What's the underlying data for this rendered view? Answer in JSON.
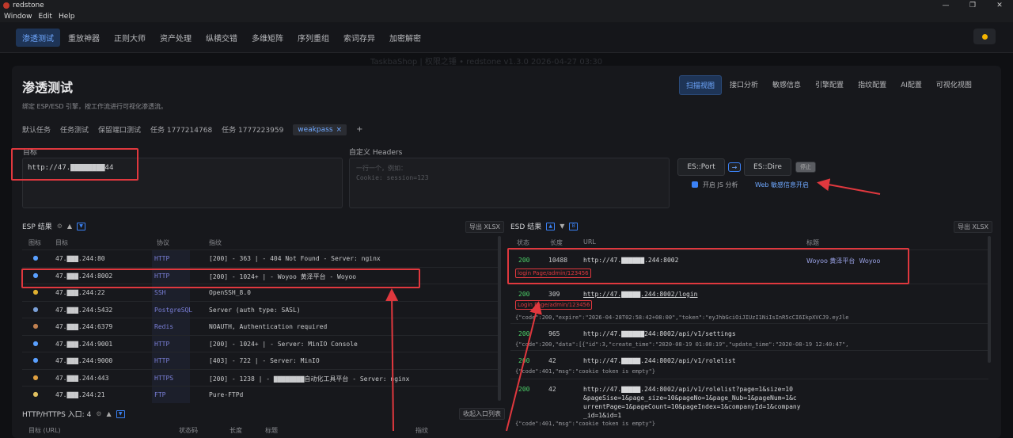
{
  "window": {
    "title": "redstone",
    "controls": [
      "—",
      "❐",
      "✕"
    ]
  },
  "menu": [
    "Window",
    "Edit",
    "Help"
  ],
  "topnav": {
    "items": [
      "渗透测试",
      "重放神器",
      "正则大师",
      "资产处理",
      "纵横交错",
      "多维矩阵",
      "序列重组",
      "索词存异",
      "加密解密"
    ]
  },
  "watermark": "TaskbaShop | 权限之锤 • redstone v1.3.0 2026-04-27 03:30",
  "page": {
    "title": "渗透测试",
    "subtitle": "绑定 ESP/ESD 引擎，按工作流进行可视化渗透流。"
  },
  "view_tabs": [
    "扫描视图",
    "接口分析",
    "敏感信息",
    "引擎配置",
    "指纹配置",
    "AI配置",
    "可视化视图"
  ],
  "task_tabs": [
    "默认任务",
    "任务测试",
    "保留端口测试",
    "任务 1777214768",
    "任务 1777223959",
    "weakpass"
  ],
  "task_tab_close": "×",
  "task_tab_add": "+",
  "target": {
    "label": "目标",
    "value": "http://47.▇▇▇▇▇▇▇▇44"
  },
  "headers": {
    "label": "自定义 Headers",
    "placeholder": "一行一个，例如：\nCookie: session=123"
  },
  "controls": {
    "es_port": "ES::Port",
    "arrow_btn": "→",
    "es_dire": "ES::Dire",
    "stop": "停止",
    "js_label": "开启 JS 分析",
    "web_label": "Web 敏感信息开启"
  },
  "esp": {
    "title": "ESP 结果",
    "export": "导出 XLSX",
    "columns": [
      "图标",
      "目标",
      "协议",
      "指纹"
    ],
    "rows": [
      {
        "icon": "globe",
        "target": "47.▇▇▇.244:80",
        "proto": "HTTP",
        "fp": "[200] - 363 | - 404 Not Found - Server: nginx"
      },
      {
        "icon": "globe",
        "target": "47.▇▇▇.244:8002",
        "proto": "HTTP",
        "fp": "[200] - 1024+ | - Woyoo 黄泽平台 - Woyoo"
      },
      {
        "icon": "key",
        "target": "47.▇▇▇.244:22",
        "proto": "SSH",
        "fp": "OpenSSH_8.0"
      },
      {
        "icon": "db",
        "target": "47.▇▇▇.244:5432",
        "proto": "PostgreSQL",
        "fp": "Server (auth type: SASL)"
      },
      {
        "icon": "box",
        "target": "47.▇▇▇.244:6379",
        "proto": "Redis",
        "fp": "NOAUTH, Authentication required"
      },
      {
        "icon": "globe",
        "target": "47.▇▇▇.244:9001",
        "proto": "HTTP",
        "fp": "[200] - 1024+ | - Server: MinIO Console"
      },
      {
        "icon": "globe",
        "target": "47.▇▇▇.244:9000",
        "proto": "HTTP",
        "fp": "[403] - 722 | - Server: MinIO"
      },
      {
        "icon": "lock",
        "target": "47.▇▇▇.244:443",
        "proto": "HTTPS",
        "fp": "[200] - 1238 | - ▇▇▇▇▇▇▇▇自动化工具平台 - Server: nginx"
      },
      {
        "icon": "folder",
        "target": "47.▇▇▇.244:21",
        "proto": "FTP",
        "fp": "Pure-FTPd"
      }
    ]
  },
  "http_entry": {
    "title": "HTTP/HTTPS 入口: 4",
    "collapse": "收起入口列表",
    "columns": [
      "目标 (URL)",
      "状态码",
      "长度",
      "标题",
      "指纹"
    ]
  },
  "esd": {
    "title": "ESD 结果",
    "export": "导出 XLSX",
    "columns": [
      "状态",
      "长度",
      "URL",
      "标题"
    ],
    "rows": [
      {
        "status": "200",
        "length": "10488",
        "url": "http://47.▇▇▇▇▇▇.244:8002",
        "title": "Woyoo 黄泽平台  Woyoo",
        "tag": "login Page/admin/123456",
        "json": ""
      },
      {
        "status": "200",
        "length": "309",
        "url": "http://47.▇▇▇▇▇.244:8002/login",
        "title": "",
        "tag": "Login Page/admin/123456",
        "json": "{\"code\":200,\"expire\":\"2026-04-28T02:58:42+08:00\",\"token\":\"eyJhbGciOiJIUzI1NiIsInR5cCI6IkpXVCJ9.eyJle"
      },
      {
        "status": "200",
        "length": "965",
        "url": "http://47.▇▇▇▇▇▇244:8002/api/v1/settings",
        "title": "",
        "tag": "",
        "json": "{\"code\":200,\"data\":[{\"id\":3,\"create_time\":\"2020-08-19 01:00:19\",\"update_time\":\"2020-08-19 12:40:47\","
      },
      {
        "status": "200",
        "length": "42",
        "url": "http://47.▇▇▇▇▇.244:8002/api/v1/rolelist",
        "title": "",
        "tag": "",
        "json": "{\"code\":401,\"msg\":\"cookie token is empty\"}"
      },
      {
        "status": "200",
        "length": "42",
        "url": "http://47.▇▇▇▇▇.244:8002/api/v1/rolelist?page=1&size=10\n&pageSise=1&page_size=10&pageNo=1&page_Nub=1&pageNum=1&c\nurrentPage=1&pageCount=10&pageIndex=1&companyId=1&company\n_id=1&id=1",
        "title": "",
        "tag": "",
        "json": "{\"code\":401,\"msg\":\"cookie token is empty\"}"
      }
    ]
  },
  "colors": {
    "accent": "#3b82f6",
    "annotation": "#e0383e",
    "status_ok": "#4ccf68"
  }
}
